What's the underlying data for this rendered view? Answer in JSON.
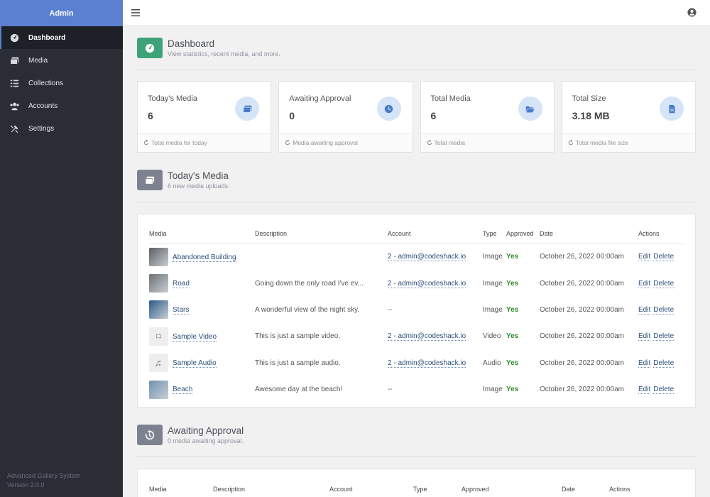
{
  "sidebar": {
    "brand": "Admin",
    "items": [
      {
        "label": "Dashboard",
        "icon": "gauge-icon",
        "active": true
      },
      {
        "label": "Media",
        "icon": "images-icon"
      },
      {
        "label": "Collections",
        "icon": "list-icon"
      },
      {
        "label": "Accounts",
        "icon": "users-icon"
      },
      {
        "label": "Settings",
        "icon": "tools-icon"
      }
    ],
    "footer": {
      "name": "Advanced Gallery System",
      "version": "Version 2.0.0"
    }
  },
  "topbar": {
    "menu_icon": "hamburger-icon",
    "profile_icon": "user-circle-icon"
  },
  "dashboard": {
    "title": "Dashboard",
    "subtitle": "View statistics, recent media, and more.",
    "icon_color": "#3fa37a"
  },
  "stats": [
    {
      "label": "Today's Media",
      "value": "6",
      "footer": "Total media for today",
      "icon": "images-icon"
    },
    {
      "label": "Awaiting Approval",
      "value": "0",
      "footer": "Media awaiting approval",
      "icon": "clock-icon"
    },
    {
      "label": "Total Media",
      "value": "6",
      "footer": "Total media",
      "icon": "folder-open-icon"
    },
    {
      "label": "Total Size",
      "value": "3.18 MB",
      "footer": "Total media file size",
      "icon": "file-icon"
    }
  ],
  "todays_media": {
    "title": "Today's Media",
    "subtitle": "6 new media uploads.",
    "icon_color": "#7e8290",
    "columns": [
      "Media",
      "Description",
      "Account",
      "Type",
      "Approved",
      "Date",
      "Actions"
    ],
    "rows": [
      {
        "title": "Abandoned Building",
        "description": "",
        "account": "2 - admin@codeshack.io",
        "type": "Image",
        "approved": "Yes",
        "date": "October 26, 2022 00:00am",
        "edit": "Edit",
        "delete": "Delete",
        "thumb": "#5a5f63"
      },
      {
        "title": "Road",
        "description": "Going down the only road I've ev...",
        "account": "2 - admin@codeshack.io",
        "type": "Image",
        "approved": "Yes",
        "date": "October 26, 2022 00:00am",
        "edit": "Edit",
        "delete": "Delete",
        "thumb": "#6d7176"
      },
      {
        "title": "Stars",
        "description": "A wonderful view of the night sky.",
        "account": "--",
        "type": "Image",
        "approved": "Yes",
        "date": "October 26, 2022 00:00am",
        "edit": "Edit",
        "delete": "Delete",
        "thumb": "#2a5a8a"
      },
      {
        "title": "Sample Video",
        "description": "This is just a sample video.",
        "account": "2 - admin@codeshack.io",
        "type": "Video",
        "approved": "Yes",
        "date": "October 26, 2022 00:00am",
        "edit": "Edit",
        "delete": "Delete",
        "thumb": ""
      },
      {
        "title": "Sample Audio",
        "description": "This is just a sample audio.",
        "account": "2 - admin@codeshack.io",
        "type": "Audio",
        "approved": "Yes",
        "date": "October 26, 2022 00:00am",
        "edit": "Edit",
        "delete": "Delete",
        "thumb": ""
      },
      {
        "title": "Beach",
        "description": "Awesome day at the beach!",
        "account": "--",
        "type": "Image",
        "approved": "Yes",
        "date": "October 26, 2022 00:00am",
        "edit": "Edit",
        "delete": "Delete",
        "thumb": "#6f93b0"
      }
    ]
  },
  "awaiting": {
    "title": "Awaiting Approval",
    "subtitle": "0 media awaiting approval.",
    "icon_color": "#7e8290",
    "columns": [
      "Media",
      "Description",
      "Account",
      "Type",
      "Approved",
      "Date",
      "Actions"
    ]
  }
}
